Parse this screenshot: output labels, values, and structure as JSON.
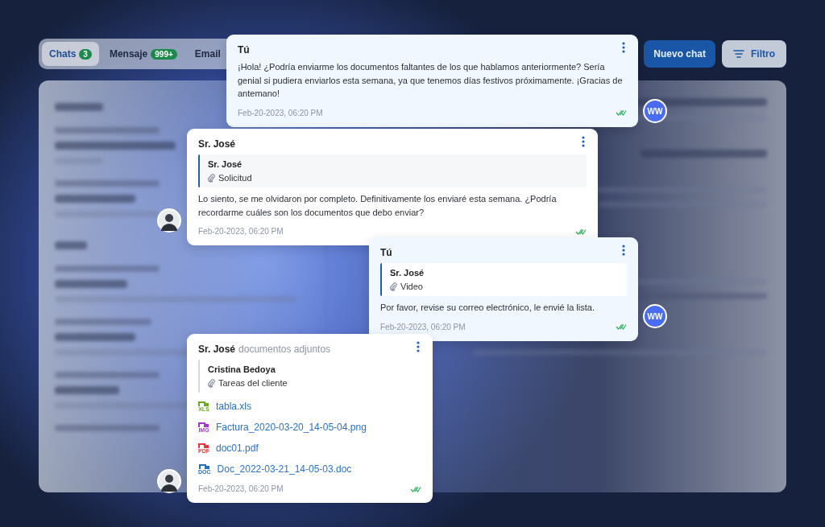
{
  "tabs": [
    {
      "label": "Chats",
      "count": "3",
      "selected": true
    },
    {
      "label": "Mensaje",
      "count": "999+",
      "selected": false
    },
    {
      "label": "Email",
      "selected": false
    }
  ],
  "new_chat_button": "Nuevo chat",
  "filter_button": "Filtro",
  "messages": [
    {
      "kind": "own",
      "author": "Tú",
      "text": "¡Hola! ¿Podría enviarme los documentos faltantes de los que hablamos anteriormente? Sería genial si pudiera enviarlos esta semana, ya que tenemos días festivos próximamente. ¡Gracias de antemano!",
      "time": "Feb-20-2023, 06:20 PM",
      "read": true,
      "avatar": "WW"
    },
    {
      "kind": "contact",
      "author": "Sr. José",
      "reply": {
        "author": "Sr. José",
        "attachment": "Solicitud"
      },
      "text": "Lo siento, se me olvidaron por completo. Definitivamente los enviaré esta semana. ¿Podría recordarme cuáles son los documentos que debo enviar?",
      "time": "Feb-20-2023, 06:20 PM",
      "read": true
    },
    {
      "kind": "own",
      "author": "Tú",
      "reply": {
        "author": "Sr. José",
        "attachment": "Video"
      },
      "text": "Por favor, revise su correo electrónico, le envié la lista.",
      "time": "Feb-20-2023, 06:20 PM",
      "read": true,
      "avatar": "WW"
    },
    {
      "kind": "contact",
      "author": "Sr. José",
      "note": "documentos adjuntos",
      "reply": {
        "author": "Cristina Bedoya",
        "attachment": "Tareas del cliente"
      },
      "files": [
        {
          "name": "tabla.xls",
          "badge": "XLS",
          "color": "#6aab1e"
        },
        {
          "name": "Factura_2020-03-20_14-05-04.png",
          "badge": "IMG",
          "color": "#a335d6"
        },
        {
          "name": "doc01.pdf",
          "badge": "PDF",
          "color": "#e5383b"
        },
        {
          "name": "Doc_2022-03-21_14-05-03.doc",
          "badge": "DOC",
          "color": "#1f6fc4"
        }
      ],
      "time": "Feb-20-2023, 06:20 PM",
      "read": true
    }
  ]
}
